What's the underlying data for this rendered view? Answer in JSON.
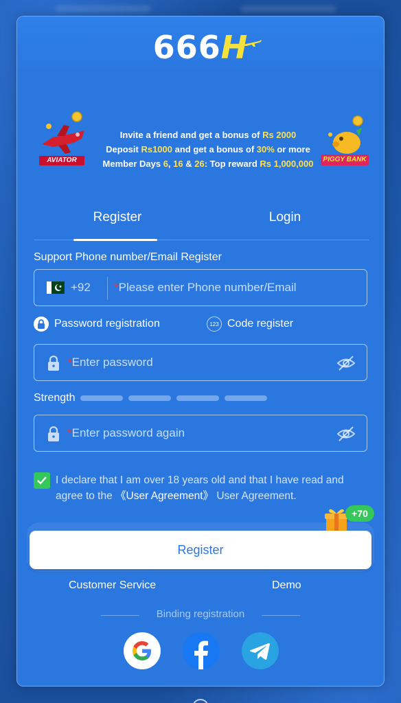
{
  "brand": {
    "logo_text": "666",
    "logo_h": "H"
  },
  "promo": {
    "aviator_label": "AVIATOR",
    "piggy_label": "PIGGY BANK",
    "line1_a": "Invite a friend and get a bonus of ",
    "line1_b": "Rs 2000",
    "line2_a": "Deposit ",
    "line2_b": "Rs1000",
    "line2_c": " and get a bonus of ",
    "line2_d": "30%",
    "line2_e": " or more",
    "line3_a": "Member Days ",
    "line3_b": "6",
    "line3_c": ", ",
    "line3_d": "16",
    "line3_e": " & ",
    "line3_f": "26",
    "line3_g": ": Top reward ",
    "line3_h": "Rs 1,000,000"
  },
  "tabs": [
    {
      "label": "Register",
      "active": true
    },
    {
      "label": "Login",
      "active": false
    }
  ],
  "form": {
    "support_label": "Support Phone number/Email Register",
    "country_code": "+92",
    "required_mark": "*",
    "phone_placeholder": "Please enter Phone number/Email",
    "password_registration": "Password registration",
    "code_register": "Code register",
    "code_icon_text": "123",
    "password_placeholder": "Enter password",
    "strength_label": "Strength",
    "confirm_placeholder": "Enter password again",
    "agreement_text": "I declare that I am over 18 years old and that I have read and agree to the ",
    "agreement_link": "《User Agreement》",
    "agreement_tail": " User Agreement.",
    "agreement_checked": true
  },
  "bonus_badge": "+70",
  "register_button": "Register",
  "links": {
    "customer_service": "Customer Service",
    "demo": "Demo"
  },
  "binding_label": "Binding registration",
  "colors": {
    "background": "#1c56a8",
    "card": "#2a77e0",
    "accent_yellow": "#ffe14d",
    "check_green": "#34c759",
    "required_red": "#ff3030"
  }
}
